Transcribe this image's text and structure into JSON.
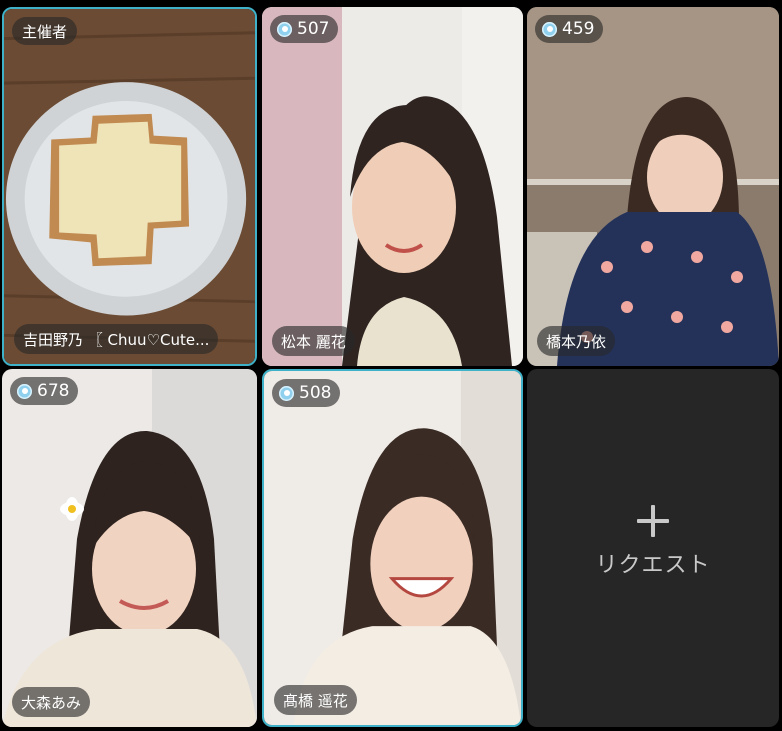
{
  "tiles": [
    {
      "badge": "主催者",
      "name": "吉田野乃 〖 Chuu♡Cute..."
    },
    {
      "viewer_count": "507",
      "name": "松本 麗花"
    },
    {
      "viewer_count": "459",
      "name": "橋本乃依"
    },
    {
      "viewer_count": "678",
      "name": "大森あみ"
    },
    {
      "viewer_count": "508",
      "name": "髙橋 遥花"
    }
  ],
  "request_slot": {
    "icon": "plus-icon",
    "label": "リクエスト"
  },
  "colors": {
    "active_border": "#3fb2c9",
    "badge_bg": "rgba(40,40,40,0.62)",
    "empty_tile_bg": "#262626",
    "viewer_icon": "#8fd0ef"
  }
}
